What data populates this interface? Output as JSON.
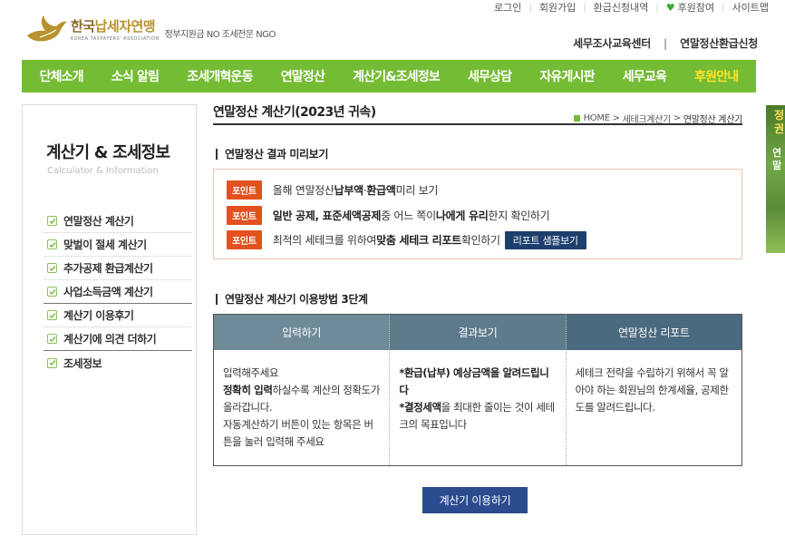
{
  "util_links": [
    "로그인",
    "회원가입",
    "환급신청내역",
    "후원참여",
    "사이트맵"
  ],
  "logo": {
    "main_a": "한국",
    "main_b": "납세자연맹",
    "sub": "KOREA TAXPAYERS' ASSOCIATION",
    "tagline": "정부지원금 NO 조세전문 NGO"
  },
  "top_links": [
    "세무조사교육센터",
    "연말정산환급신청"
  ],
  "nav": [
    "단체소개",
    "소식 알림",
    "조세개혁운동",
    "연말정산",
    "계산기&조세정보",
    "세무상담",
    "자유게시판",
    "세무교육",
    "후원안내"
  ],
  "side_banner": {
    "line1": "정",
    "line2": "권",
    "line3": "연",
    "line4": "말"
  },
  "sidebar": {
    "title": "계산기 & 조세정보",
    "subtitle": "Calculator & Information",
    "items": [
      "연말정산 계산기",
      "맞벌이 절세 계산기",
      "추가공제 환급계산기",
      "사업소득금액 계산기",
      "계산기 이용후기",
      "계산기에 의견 더하기",
      "조세정보"
    ]
  },
  "page": {
    "title": "연말정산 계산기(2023년 귀속)",
    "breadcrumb": {
      "home": "HOME",
      "parent": "세테크계산기",
      "current": "연말정산 계산기"
    }
  },
  "section1": {
    "title": "연말정산 결과 미리보기",
    "tag": "포인트",
    "p1": {
      "a": "올해 연말정산 ",
      "b": "납부액",
      "c": " · ",
      "d": "환급액",
      "e": " 미리 보기"
    },
    "p2": {
      "a": "일반 공제, 표준세액공제",
      "b": " 중 어느 쪽이 ",
      "c": "나에게 유리",
      "d": "한지 확인하기"
    },
    "p3": {
      "a": "최적의 세테크를 위하여 ",
      "b": "맞춤 세테크 리포트",
      "c": " 확인하기",
      "button": "리포트 샘플보기"
    }
  },
  "section2": {
    "title": "연말정산 계산기 이용방법 3단계",
    "headers": [
      "입력하기",
      "결과보기",
      "연말정산 리포트"
    ],
    "col1": {
      "l1": "입력해주세요",
      "l2b": "정확히 입력",
      "l2": "하실수록 계산의 정확도가 올라갑니다.",
      "l3": "자동계산하기 버튼이 있는 항목은 버튼을 눌러 입력해 주세요"
    },
    "col2": {
      "l1b": "*환급(납부) 예상금액을 알려드립니다",
      "l2b": "*결정세액",
      "l2": "을 최대한 줄이는 것이 세테크의 목표입니다"
    },
    "col3": {
      "l1": "세테크 전략을 수립하기 위해서 꼭 알아야 하는 회원님의 한계세율, 공제한도를 알려드립니다."
    }
  },
  "use_button": "계산기 이용하기",
  "colors": {
    "nav_green": "#75bc35",
    "point_tag": "#e2511f",
    "navy_button": "#2a4b8e",
    "highlight_yellow": "#ffe32b"
  }
}
